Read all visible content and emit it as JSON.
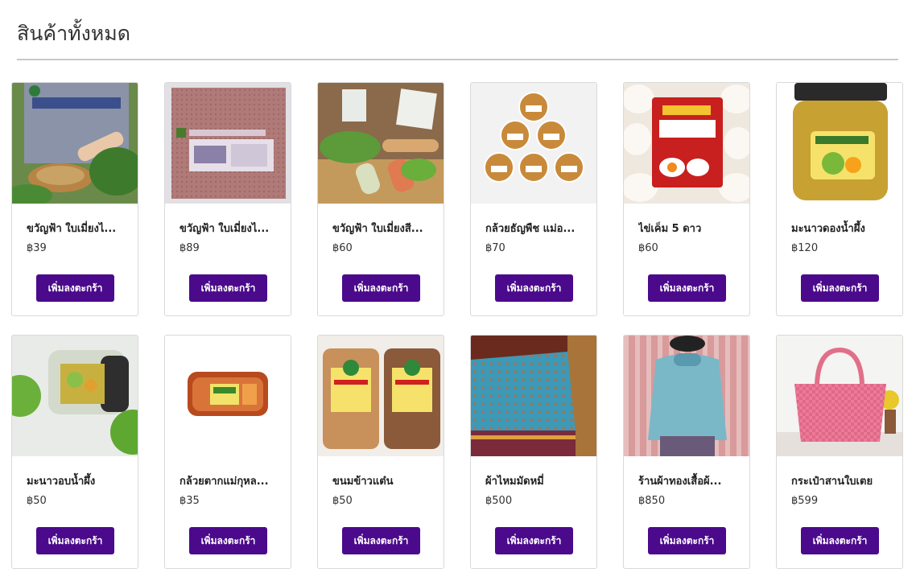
{
  "page": {
    "title": "สินค้าทั้งหมด"
  },
  "add_to_cart_label": "เพิ่มลงตะกร้า",
  "colors": {
    "button": "#4b0a8c",
    "button_text": "#ffffff",
    "divider": "#c8c8c8"
  },
  "products": [
    {
      "name": "ขวัญฟ้า ใบเมี่ยงไ...",
      "price": "฿39"
    },
    {
      "name": "ขวัญฟ้า ใบเมี่ยงไ...",
      "price": "฿89"
    },
    {
      "name": "ขวัญฟ้า ใบเมี่ยงสี...",
      "price": "฿60"
    },
    {
      "name": "กล้วยธัญพืช แม่อ...",
      "price": "฿70"
    },
    {
      "name": "ไข่เค็ม 5 ดาว",
      "price": "฿60"
    },
    {
      "name": "มะนาวดองน้ำผึ้ง",
      "price": "฿120"
    },
    {
      "name": "มะนาวอบน้ำผึ้ง",
      "price": "฿50"
    },
    {
      "name": "กล้วยตากแม่กุหล...",
      "price": "฿35"
    },
    {
      "name": "ขนมข้าวแต๋น",
      "price": "฿50"
    },
    {
      "name": "ผ้าไหมมัดหมี่",
      "price": "฿500"
    },
    {
      "name": "ร้านผ้าทองเสื้อผ้...",
      "price": "฿850"
    },
    {
      "name": "กระเป๋าสานใบเตย",
      "price": "฿599"
    }
  ]
}
